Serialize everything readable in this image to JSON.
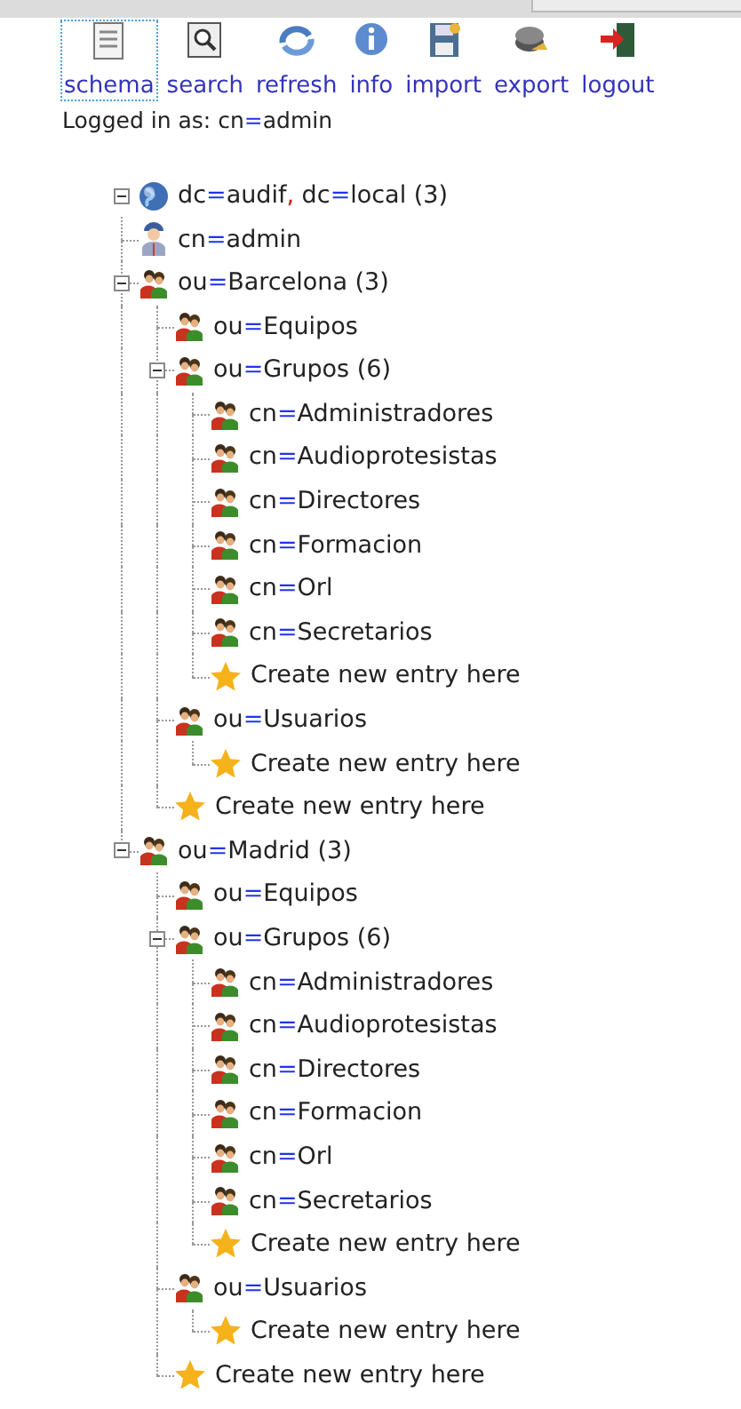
{
  "toolbar": [
    {
      "kind": "schema",
      "label": "schema",
      "focused": true
    },
    {
      "kind": "search",
      "label": "search",
      "focused": false
    },
    {
      "kind": "refresh",
      "label": "refresh",
      "focused": false
    },
    {
      "kind": "info",
      "label": "info",
      "focused": false
    },
    {
      "kind": "import",
      "label": "import",
      "focused": false
    },
    {
      "kind": "export",
      "label": "export",
      "focused": false
    },
    {
      "kind": "logout",
      "label": "logout",
      "focused": false
    }
  ],
  "login": {
    "text": "Logged in as: cn",
    "eq": "=",
    "user": "admin"
  },
  "tree": {
    "kind": "root",
    "expanded": true,
    "label": [
      {
        "kind": "text",
        "text": "dc"
      },
      {
        "kind": "eq",
        "text": "="
      },
      {
        "kind": "text",
        "text": "audif"
      },
      {
        "kind": "comma",
        "text": ","
      },
      {
        "kind": "text",
        "text": " dc"
      },
      {
        "kind": "eq",
        "text": "="
      },
      {
        "kind": "text",
        "text": "local (3)"
      }
    ],
    "children": [
      {
        "kind": "user",
        "label": [
          {
            "kind": "text",
            "text": "cn"
          },
          {
            "kind": "eq",
            "text": "="
          },
          {
            "kind": "text",
            "text": "admin"
          }
        ]
      },
      {
        "kind": "group",
        "expanded": true,
        "label": [
          {
            "kind": "text",
            "text": "ou"
          },
          {
            "kind": "eq",
            "text": "="
          },
          {
            "kind": "text",
            "text": "Barcelona (3)"
          }
        ],
        "children": [
          {
            "kind": "group",
            "label": [
              {
                "kind": "text",
                "text": "ou"
              },
              {
                "kind": "eq",
                "text": "="
              },
              {
                "kind": "text",
                "text": "Equipos"
              }
            ]
          },
          {
            "kind": "group",
            "expanded": true,
            "label": [
              {
                "kind": "text",
                "text": "ou"
              },
              {
                "kind": "eq",
                "text": "="
              },
              {
                "kind": "text",
                "text": "Grupos (6)"
              }
            ],
            "children": [
              {
                "kind": "group",
                "label": [
                  {
                    "kind": "text",
                    "text": "cn"
                  },
                  {
                    "kind": "eq",
                    "text": "="
                  },
                  {
                    "kind": "text",
                    "text": "Administradores"
                  }
                ]
              },
              {
                "kind": "group",
                "label": [
                  {
                    "kind": "text",
                    "text": "cn"
                  },
                  {
                    "kind": "eq",
                    "text": "="
                  },
                  {
                    "kind": "text",
                    "text": "Audioprotesistas"
                  }
                ]
              },
              {
                "kind": "group",
                "label": [
                  {
                    "kind": "text",
                    "text": "cn"
                  },
                  {
                    "kind": "eq",
                    "text": "="
                  },
                  {
                    "kind": "text",
                    "text": "Directores"
                  }
                ]
              },
              {
                "kind": "group",
                "label": [
                  {
                    "kind": "text",
                    "text": "cn"
                  },
                  {
                    "kind": "eq",
                    "text": "="
                  },
                  {
                    "kind": "text",
                    "text": "Formacion"
                  }
                ]
              },
              {
                "kind": "group",
                "label": [
                  {
                    "kind": "text",
                    "text": "cn"
                  },
                  {
                    "kind": "eq",
                    "text": "="
                  },
                  {
                    "kind": "text",
                    "text": "Orl"
                  }
                ]
              },
              {
                "kind": "group",
                "label": [
                  {
                    "kind": "text",
                    "text": "cn"
                  },
                  {
                    "kind": "eq",
                    "text": "="
                  },
                  {
                    "kind": "text",
                    "text": "Secretarios"
                  }
                ]
              },
              {
                "kind": "create",
                "label": [
                  {
                    "kind": "text",
                    "text": "Create new entry here"
                  }
                ]
              }
            ]
          },
          {
            "kind": "group",
            "label": [
              {
                "kind": "text",
                "text": "ou"
              },
              {
                "kind": "eq",
                "text": "="
              },
              {
                "kind": "text",
                "text": "Usuarios"
              }
            ],
            "children": [
              {
                "kind": "create",
                "label": [
                  {
                    "kind": "text",
                    "text": "Create new entry here"
                  }
                ]
              }
            ]
          },
          {
            "kind": "create",
            "label": [
              {
                "kind": "text",
                "text": "Create new entry here"
              }
            ]
          }
        ]
      },
      {
        "kind": "group",
        "expanded": true,
        "label": [
          {
            "kind": "text",
            "text": "ou"
          },
          {
            "kind": "eq",
            "text": "="
          },
          {
            "kind": "text",
            "text": "Madrid (3)"
          }
        ],
        "children": [
          {
            "kind": "group",
            "label": [
              {
                "kind": "text",
                "text": "ou"
              },
              {
                "kind": "eq",
                "text": "="
              },
              {
                "kind": "text",
                "text": "Equipos"
              }
            ]
          },
          {
            "kind": "group",
            "expanded": true,
            "label": [
              {
                "kind": "text",
                "text": "ou"
              },
              {
                "kind": "eq",
                "text": "="
              },
              {
                "kind": "text",
                "text": "Grupos (6)"
              }
            ],
            "children": [
              {
                "kind": "group",
                "label": [
                  {
                    "kind": "text",
                    "text": "cn"
                  },
                  {
                    "kind": "eq",
                    "text": "="
                  },
                  {
                    "kind": "text",
                    "text": "Administradores"
                  }
                ]
              },
              {
                "kind": "group",
                "label": [
                  {
                    "kind": "text",
                    "text": "cn"
                  },
                  {
                    "kind": "eq",
                    "text": "="
                  },
                  {
                    "kind": "text",
                    "text": "Audioprotesistas"
                  }
                ]
              },
              {
                "kind": "group",
                "label": [
                  {
                    "kind": "text",
                    "text": "cn"
                  },
                  {
                    "kind": "eq",
                    "text": "="
                  },
                  {
                    "kind": "text",
                    "text": "Directores"
                  }
                ]
              },
              {
                "kind": "group",
                "label": [
                  {
                    "kind": "text",
                    "text": "cn"
                  },
                  {
                    "kind": "eq",
                    "text": "="
                  },
                  {
                    "kind": "text",
                    "text": "Formacion"
                  }
                ]
              },
              {
                "kind": "group",
                "label": [
                  {
                    "kind": "text",
                    "text": "cn"
                  },
                  {
                    "kind": "eq",
                    "text": "="
                  },
                  {
                    "kind": "text",
                    "text": "Orl"
                  }
                ]
              },
              {
                "kind": "group",
                "label": [
                  {
                    "kind": "text",
                    "text": "cn"
                  },
                  {
                    "kind": "eq",
                    "text": "="
                  },
                  {
                    "kind": "text",
                    "text": "Secretarios"
                  }
                ]
              },
              {
                "kind": "create",
                "label": [
                  {
                    "kind": "text",
                    "text": "Create new entry here"
                  }
                ]
              }
            ]
          },
          {
            "kind": "group",
            "label": [
              {
                "kind": "text",
                "text": "ou"
              },
              {
                "kind": "eq",
                "text": "="
              },
              {
                "kind": "text",
                "text": "Usuarios"
              }
            ],
            "children": [
              {
                "kind": "create",
                "label": [
                  {
                    "kind": "text",
                    "text": "Create new entry here"
                  }
                ]
              }
            ]
          },
          {
            "kind": "create",
            "label": [
              {
                "kind": "text",
                "text": "Create new entry here"
              }
            ]
          }
        ]
      }
    ]
  }
}
